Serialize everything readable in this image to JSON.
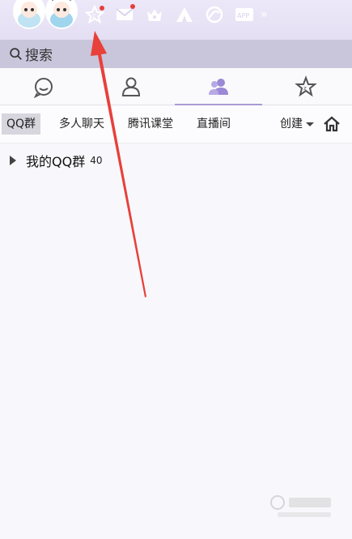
{
  "toolbar": {
    "icons": [
      "qzone-icon",
      "mail-icon",
      "crown-icon",
      "camp-icon",
      "browser-icon",
      "app-icon"
    ],
    "app_label": "APP",
    "more_glyph": "»",
    "notification_color": "#e2413b"
  },
  "search": {
    "placeholder": "搜索"
  },
  "tabs": [
    {
      "icon": "chat-bubble-icon",
      "active": false
    },
    {
      "icon": "contact-icon",
      "active": false
    },
    {
      "icon": "group-icon",
      "active": true
    },
    {
      "icon": "star-icon",
      "active": false
    }
  ],
  "subtabs": {
    "items": [
      "QQ群",
      "多人聊天",
      "腾讯课堂",
      "直播间"
    ],
    "selected": "QQ群",
    "create_label": "创建"
  },
  "groups": {
    "items": [
      {
        "name": "我的QQ群",
        "count": "40",
        "expanded": false
      }
    ]
  },
  "colors": {
    "accent": "#a99ad6",
    "header_bg": "#e6e1f5",
    "search_bg": "#c9c5da",
    "arrow": "#e8403a"
  }
}
